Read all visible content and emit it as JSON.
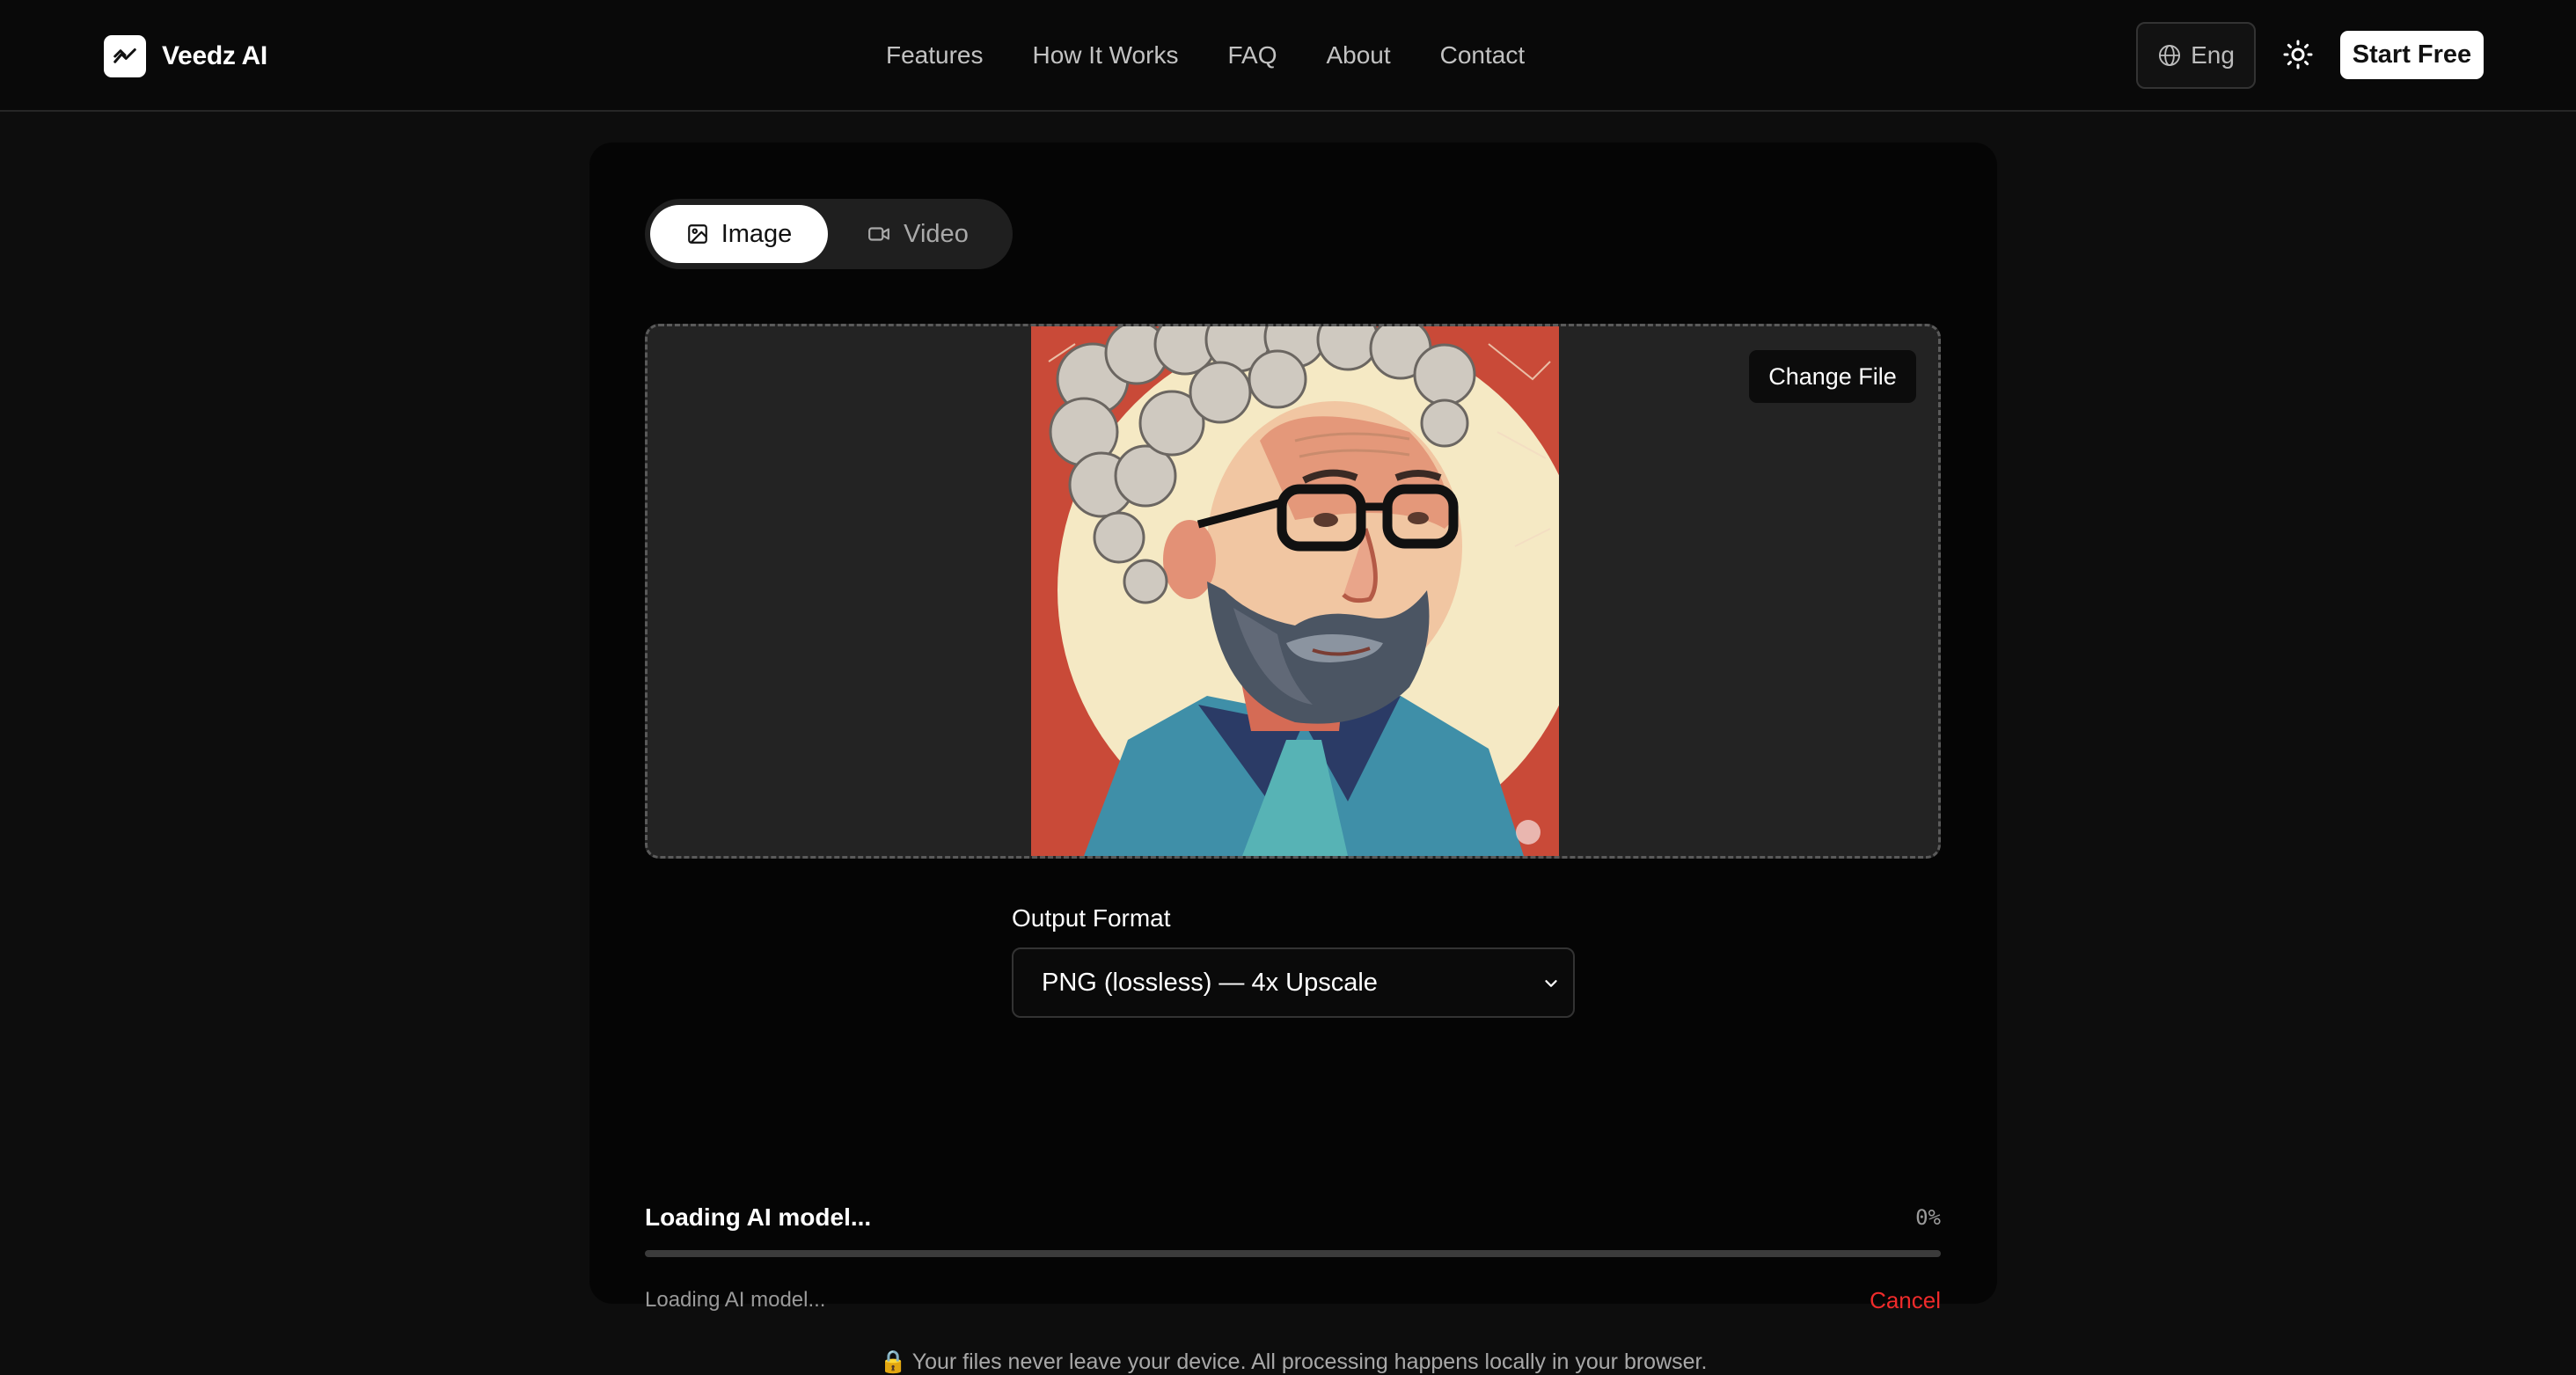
{
  "header": {
    "brand_name": "Veedz AI",
    "nav": [
      "Features",
      "How It Works",
      "FAQ",
      "About",
      "Contact"
    ],
    "language_label": "Eng",
    "start_label": "Start Free"
  },
  "tabs": {
    "image_label": "Image",
    "video_label": "Video",
    "active": "Image"
  },
  "upload": {
    "change_file_label": "Change File"
  },
  "output": {
    "label": "Output Format",
    "selected": "PNG (lossless) — 4x Upscale"
  },
  "progress": {
    "title": "Loading AI model...",
    "percent_label": "0%",
    "value": 0,
    "status": "Loading AI model...",
    "cancel_label": "Cancel"
  },
  "footer_note": {
    "icon": "🔒",
    "text": "Your files never leave your device. All processing happens locally in your browser."
  },
  "colors": {
    "background": "#0d0d0d",
    "card": "#050505",
    "accent": "#ffffff",
    "danger": "#ef2b2b"
  },
  "icons": {
    "brand": "trend-chart-icon",
    "language": "globe-icon",
    "theme": "sun-icon",
    "image_tab": "image-icon",
    "video_tab": "video-camera-icon",
    "select": "chevron-down-icon",
    "privacy": "lock-icon"
  }
}
